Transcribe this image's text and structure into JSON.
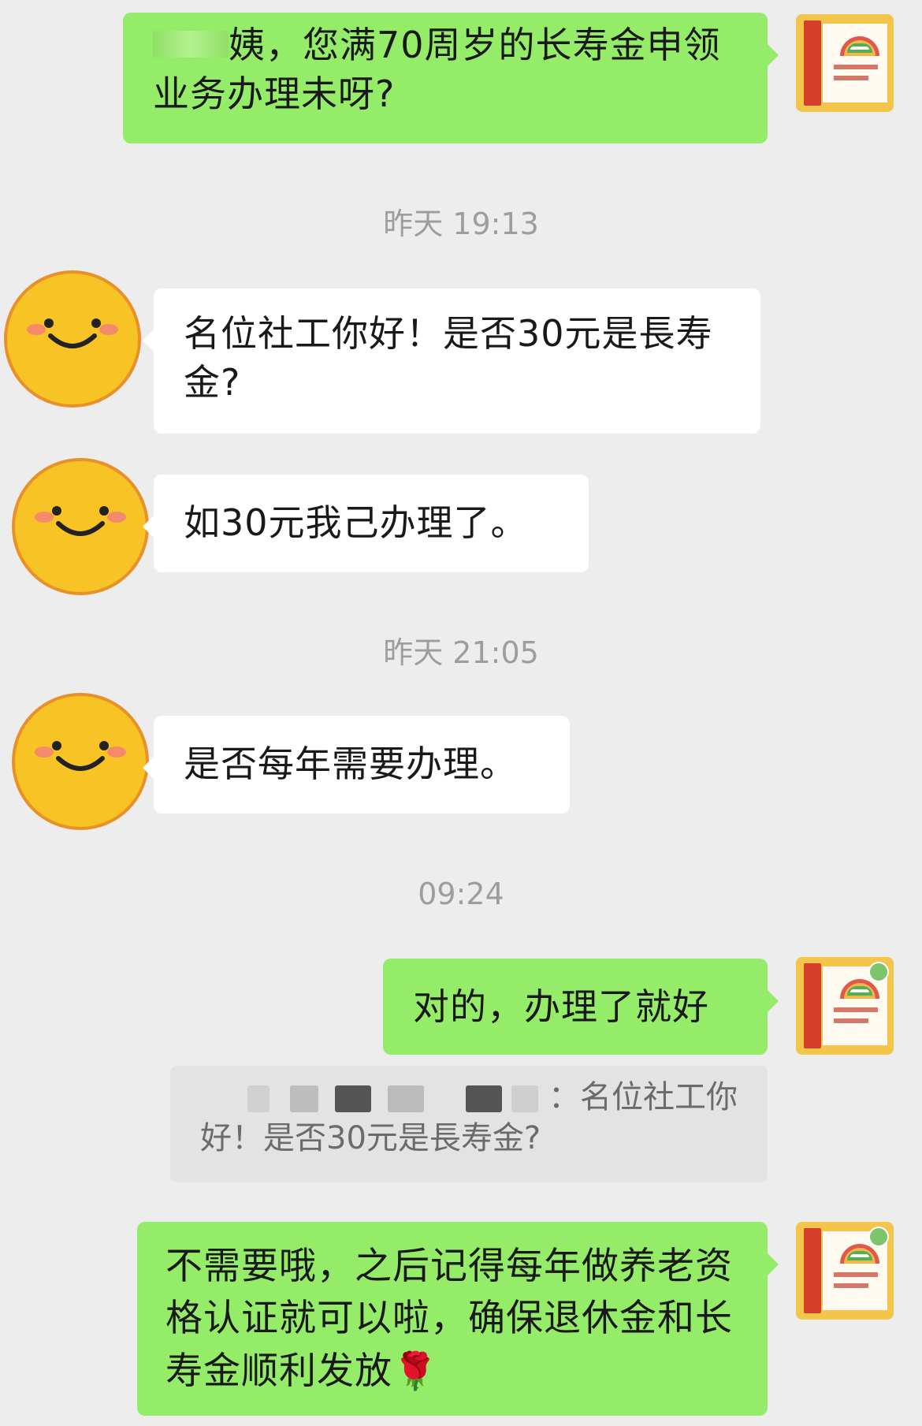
{
  "messages": [
    {
      "type": "outgoing",
      "text": "姨，您满70周岁的长寿金申领业务办理未呀?"
    },
    {
      "type": "timestamp",
      "text": "昨天 19:13"
    },
    {
      "type": "incoming",
      "text": "名位社工你好！是否30元是長寿金?"
    },
    {
      "type": "incoming",
      "text": "如30元我己办理了。"
    },
    {
      "type": "timestamp",
      "text": "昨天 21:05"
    },
    {
      "type": "incoming",
      "text": "是否每年需要办理。"
    },
    {
      "type": "timestamp",
      "text": "09:24"
    },
    {
      "type": "outgoing",
      "text": "对的，办理了就好"
    },
    {
      "type": "quote",
      "text_line1": "：名位社工你",
      "text_line2": "好！是否30元是長寿金?"
    },
    {
      "type": "outgoing",
      "text": "不需要哦，之后记得每年做养老资格认证就可以啦，确保退休金和长寿金顺利发放",
      "emoji": "🌹"
    }
  ],
  "colors": {
    "background": "#ededed",
    "outgoing_bubble": "#95ec69",
    "incoming_bubble": "#ffffff",
    "timestamp_text": "#9d9d9d",
    "smiley_face": "#f7c325"
  },
  "icons": {
    "incoming_avatar": "smiley-face-avatar",
    "outgoing_avatar": "social-work-station-logo-avatar"
  }
}
